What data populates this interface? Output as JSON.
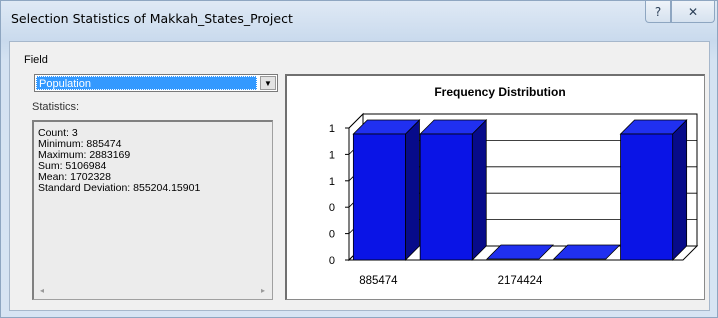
{
  "window": {
    "title": "Selection Statistics of Makkah_States_Project",
    "help_glyph": "?",
    "close_glyph": "✕"
  },
  "field": {
    "label": "Field",
    "selected": "Population",
    "dropdown_glyph": "▼"
  },
  "statistics": {
    "label": "Statistics:",
    "lines": [
      "Count:    3",
      "Minimum: 885474",
      "Maximum: 2883169",
      "Sum:      5106984",
      "Mean:     1702328",
      "Standard Deviation: 855204.15901"
    ],
    "scroll_left": "◂",
    "scroll_right": "▸"
  },
  "colors": {
    "bar_face": "#0a14e6",
    "bar_side": "#070b8a",
    "bar_top": "#2030f0"
  },
  "chart_data": {
    "type": "bar",
    "title": "Frequency Distribution",
    "values": [
      1,
      1,
      0,
      0,
      1
    ],
    "y_tick_labels": [
      "1",
      "1",
      "1",
      "0",
      "0",
      "0"
    ],
    "x_tick_labels": [
      "885474",
      "2174424"
    ],
    "ylim": [
      0,
      1
    ],
    "grid": true,
    "legend": "none"
  }
}
